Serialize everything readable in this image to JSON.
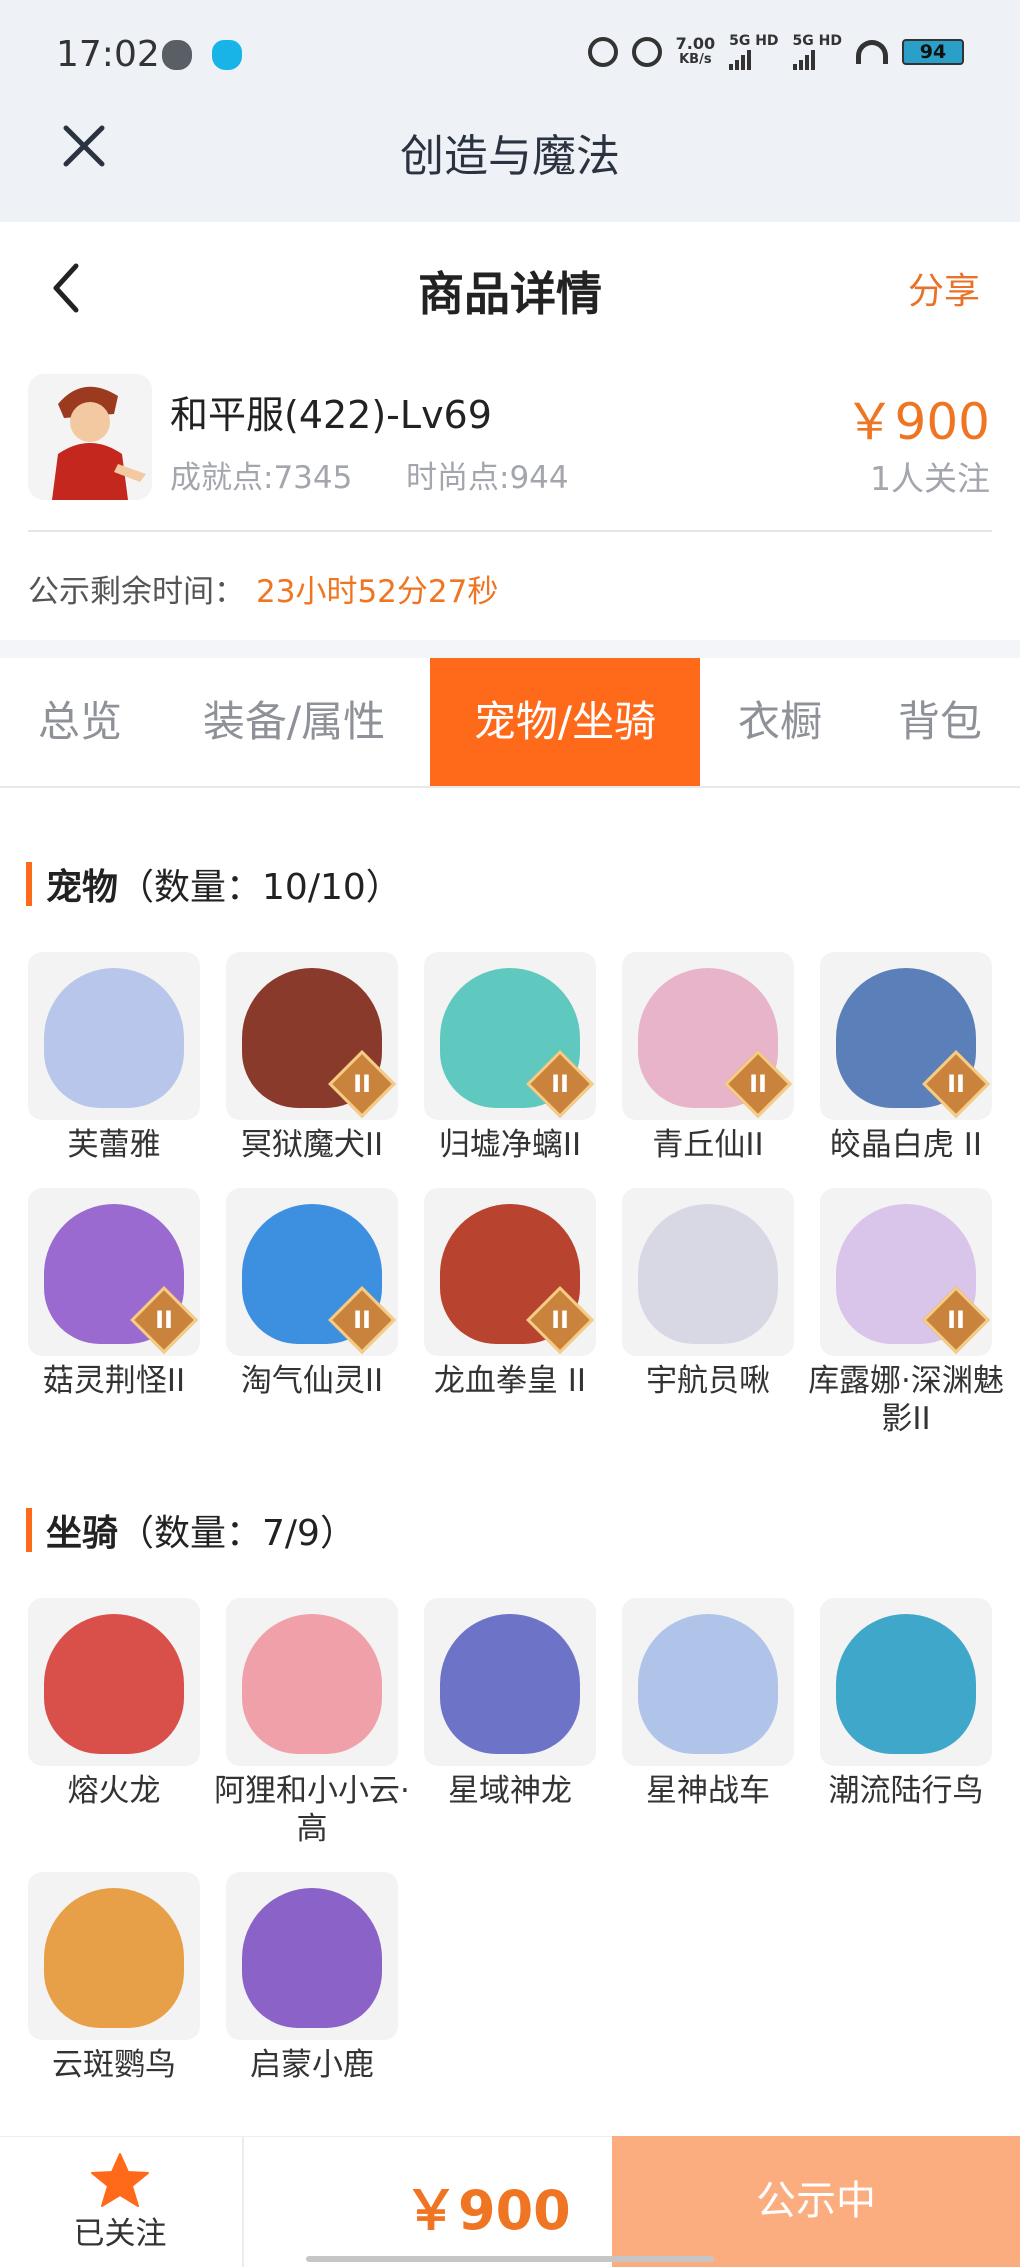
{
  "status_bar": {
    "time": "17:02",
    "net_speed": "7.00",
    "net_speed_unit": "KB/s",
    "sim1": "5G HD",
    "sim2": "5G HD",
    "battery": "94"
  },
  "app_bar": {
    "title": "创造与魔法"
  },
  "header": {
    "title": "商品详情",
    "share_label": "分享"
  },
  "listing": {
    "server": "和平服(422)-Lv69",
    "achievement": "成就点:7345",
    "fashion": "时尚点:944",
    "price": "￥900",
    "followers": "1人关注",
    "countdown_label": "公示剩余时间：",
    "countdown_value": "23小时52分27秒"
  },
  "tabs": [
    {
      "label": "总览"
    },
    {
      "label": "装备/属性"
    },
    {
      "label": "宠物/坐骑"
    },
    {
      "label": "衣橱"
    },
    {
      "label": "背包"
    }
  ],
  "active_tab": "宠物/坐骑",
  "pets": {
    "title": "宠物",
    "count": "（数量：10/10）",
    "items": [
      {
        "name": "芙蕾雅",
        "badge": "",
        "color": "#b7c6ea"
      },
      {
        "name": "冥狱魔犬II",
        "badge": "II",
        "color": "#8a3a2a"
      },
      {
        "name": "归墟净螭II",
        "badge": "II",
        "color": "#5fc9c0"
      },
      {
        "name": "青丘仙II",
        "badge": "II",
        "color": "#e8b4c9"
      },
      {
        "name": "皎晶白虎 II",
        "badge": "II",
        "color": "#5b7fb8"
      },
      {
        "name": "菇灵荆怪II",
        "badge": "II",
        "color": "#9a6ad0"
      },
      {
        "name": "淘气仙灵II",
        "badge": "II",
        "color": "#3d8fe0"
      },
      {
        "name": "龙血拳皇 II",
        "badge": "II",
        "color": "#b8432e"
      },
      {
        "name": "宇航员啾",
        "badge": "",
        "color": "#d8d8e4"
      },
      {
        "name": "库露娜·深渊魅影II",
        "badge": "II",
        "color": "#d9c4ea"
      }
    ]
  },
  "mounts": {
    "title": "坐骑",
    "count": "（数量：7/9）",
    "items": [
      {
        "name": "熔火龙",
        "color": "#d9504a"
      },
      {
        "name": "阿狸和小小云·高",
        "color": "#f0a0a8"
      },
      {
        "name": "星域神龙",
        "color": "#6d74c8"
      },
      {
        "name": "星神战车",
        "color": "#b0c4ea"
      },
      {
        "name": "潮流陆行鸟",
        "color": "#3fa7c9"
      },
      {
        "name": "云斑鹦鸟",
        "color": "#e8a048"
      },
      {
        "name": "启蒙小鹿",
        "color": "#8a62c8"
      }
    ]
  },
  "bottom_bar": {
    "followed_label": "已关注",
    "price": "￥900",
    "action_label": "公示中"
  },
  "colors": {
    "accent": "#ff6a1a",
    "price": "#ef7522",
    "action_bg": "#fbad7f"
  }
}
